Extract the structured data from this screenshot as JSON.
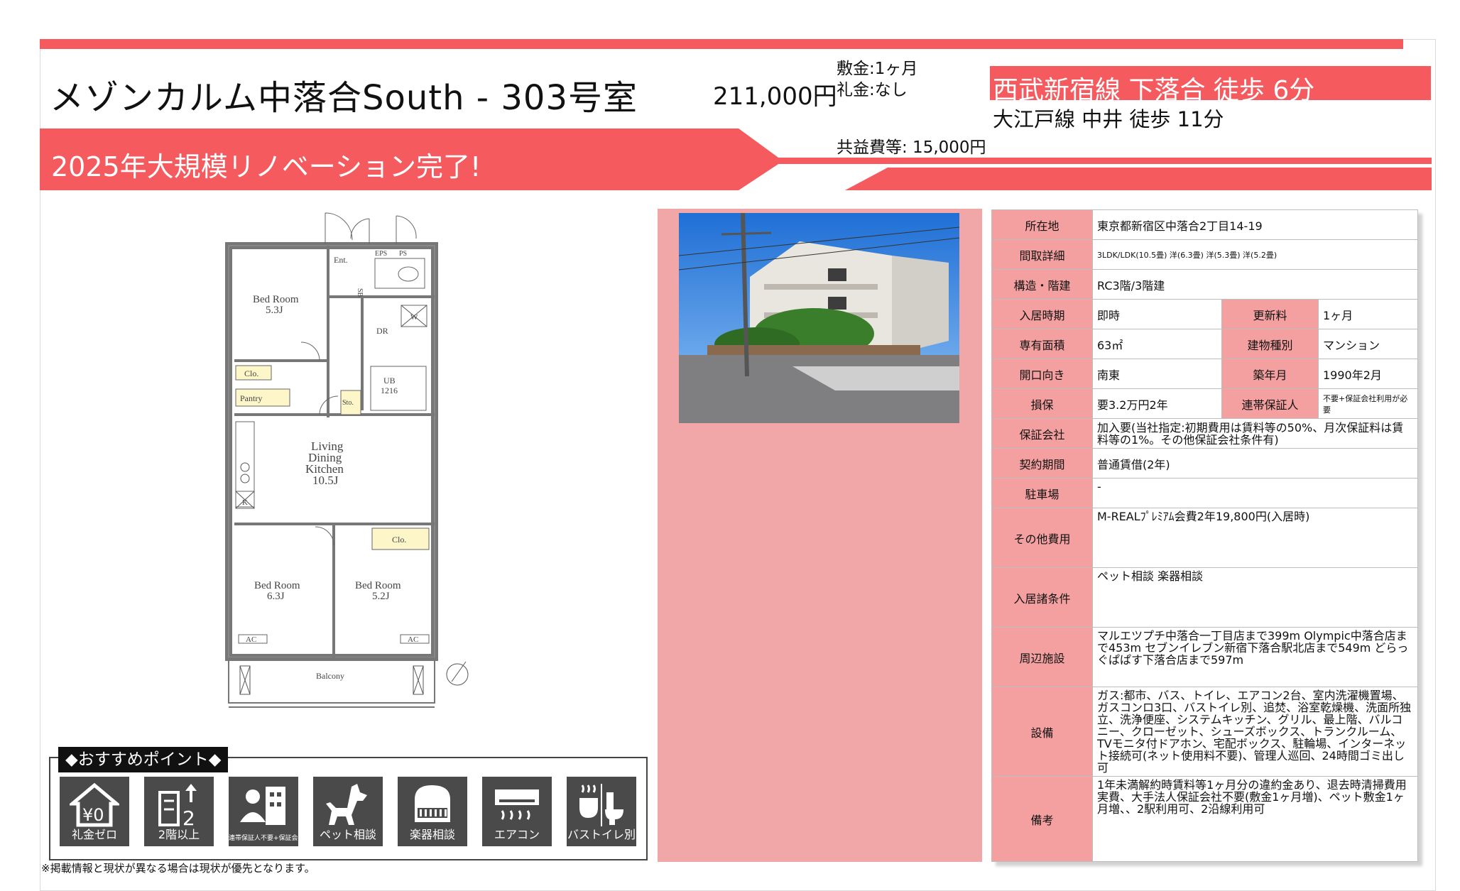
{
  "header": {
    "title": "メゾンカルム中落合South - 303号室",
    "rent": "211,000円",
    "deposit": "敷金:1ヶ月",
    "key_money": "礼金:なし",
    "common_fee": "共益費等: 15,000円",
    "station_1": "西武新宿線 下落合 徒歩 6分",
    "station_2": "大江戸線 中井 徒歩 11分",
    "banner": "2025年大規模リノベーション完了!"
  },
  "floorplan": {
    "labels": [
      "Ent.",
      "EPS",
      "PS",
      "SB",
      "W",
      "DR",
      "Bed Room",
      "5.3J",
      "Clo.",
      "Pantry",
      "Sto.",
      "UB",
      "1216",
      "Living",
      "Dining",
      "Kitchen",
      "10.5J",
      "K",
      "Clo.",
      "Bed Room",
      "6.3J",
      "Bed Room",
      "5.2J",
      "AC",
      "AC",
      "Balcony"
    ]
  },
  "spec": {
    "rows": [
      {
        "label": "所在地",
        "value": "東京都新宿区中落合2丁目14-19"
      },
      {
        "label": "間取詳細",
        "value": "3LDK/LDK(10.5畳) 洋(6.3畳) 洋(5.3畳) 洋(5.2畳)"
      },
      {
        "label": "構造・階建",
        "value": "RC3階/3階建"
      },
      {
        "label": "入居時期",
        "value": "即時",
        "label2": "更新料",
        "value2": "1ヶ月"
      },
      {
        "label": "専有面積",
        "value": "63㎡",
        "label2": "建物種別",
        "value2": "マンション"
      },
      {
        "label": "開口向き",
        "value": "南東",
        "label2": "築年月",
        "value2": "1990年2月"
      },
      {
        "label": "損保",
        "value": "要3.2万円2年",
        "label2": "連帯保証人",
        "value2": "不要+保証会社利用が必要"
      },
      {
        "label": "保証会社",
        "value": "加入要(当社指定:初期費用は賃料等の50%、月次保証料は賃料等の1%。その他保証会社条件有)"
      },
      {
        "label": "契約期間",
        "value": "普通賃借(2年)"
      },
      {
        "label": "駐車場",
        "value": "-"
      },
      {
        "label": "その他費用",
        "value": "M-REALﾌﾟﾚﾐｱﾑ会費2年19,800円(入居時)"
      },
      {
        "label": "入居諸条件",
        "value": "ペット相談 楽器相談"
      },
      {
        "label": "周辺施設",
        "value": "マルエツプチ中落合一丁目店まで399m Olympic中落合店まで453m セブンイレブン新宿下落合駅北店まで549m どらっぐぱぱす下落合店まで597m"
      },
      {
        "label": "設備",
        "value": "ガス:都市、バス、トイレ、エアコン2台、室内洗濯機置場、ガスコンロ3口、バストイレ別、追焚、浴室乾燥機、洗面所独立、洗浄便座、システムキッチン、グリル、最上階、バルコニー、クローゼット、シューズボックス、トランクルーム、TVモニタ付ドアホン、宅配ボックス、駐輪場、インターネット接続可(ネット使用料不要)、管理人巡回、24時間ゴミ出し可"
      },
      {
        "label": "備考",
        "value": "1年未満解約時賃料等1ヶ月分の違約金あり、退去時清掃費用実費、大手法人保証会社不要(敷金1ヶ月増)、ペット敷金1ヶ月増、、2駅利用可、2沿線利用可"
      }
    ]
  },
  "points": {
    "title": "◆おすすめポイント◆",
    "items": [
      {
        "icon": "yen-zero-house-icon",
        "label": "礼金ゼロ"
      },
      {
        "icon": "building-floor-2-icon",
        "label": "2階以上"
      },
      {
        "icon": "guarantor-person-building-icon",
        "label": "連帯保証人不要+保証会社利用が必要"
      },
      {
        "icon": "dog-icon",
        "label": "ペット相談"
      },
      {
        "icon": "piano-icon",
        "label": "楽器相談"
      },
      {
        "icon": "air-conditioner-icon",
        "label": "エアコン"
      },
      {
        "icon": "bath-toilet-icon",
        "label": "バストイレ別"
      }
    ]
  },
  "footer": {
    "note": "※掲載情報と現状が異なる場合は現状が優先となります。"
  },
  "colors": {
    "accent": "#f45a5e",
    "photo_panel": "#f1a7a7",
    "label_cell": "#f4a0a0",
    "icon_bg": "#4a4a4a"
  }
}
